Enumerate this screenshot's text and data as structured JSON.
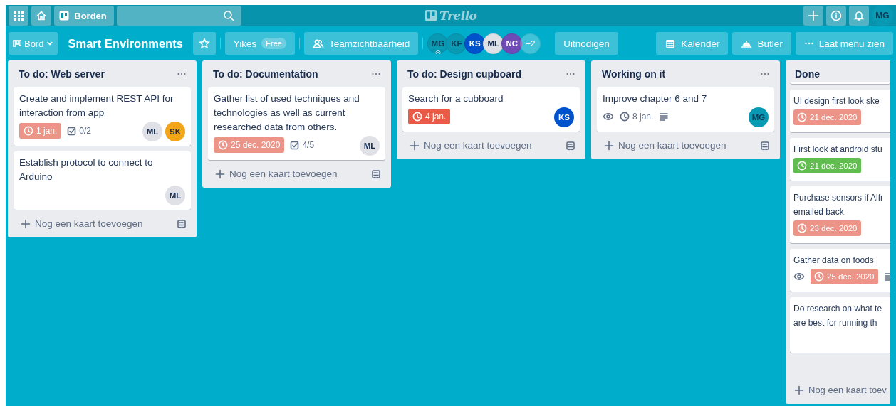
{
  "topbar": {
    "boards_label": "Borden",
    "logo": "Trello",
    "user_initials": "MG"
  },
  "board_header": {
    "view_label": "Bord",
    "title": "Smart Environments",
    "starred": false,
    "workspace": "Yikes",
    "plan": "Free",
    "visibility": "Teamzichtbaarheid",
    "members": [
      {
        "initials": "MG",
        "color": "#0a99b3",
        "admin": true
      },
      {
        "initials": "KF",
        "color": "#0a99b3",
        "admin": false
      },
      {
        "initials": "KS",
        "color": "#0052cc",
        "admin": false
      },
      {
        "initials": "ML",
        "color": "#dfe1e6",
        "admin": false
      },
      {
        "initials": "NC",
        "color": "#6e4bb7",
        "admin": false
      }
    ],
    "more_members": "+2",
    "invite": "Uitnodigen",
    "calendar": "Kalender",
    "butler": "Butler",
    "menu": "Laat menu zien"
  },
  "lists": [
    {
      "title": "To do: Web server",
      "add_card": "Nog een kaart toevoegen",
      "cards": [
        {
          "title": "Create and implement REST API for interaction from app",
          "watching": false,
          "due": {
            "text": "1 jan.",
            "color": "#ec9488"
          },
          "checklist": "0/2",
          "description": false,
          "members": [
            {
              "initials": "ML",
              "color": "#dfe1e6"
            },
            {
              "initials": "SK",
              "color": "#f2a516"
            }
          ]
        },
        {
          "title": "Establish protocol to connect to Arduino",
          "watching": false,
          "description": false,
          "members": [
            {
              "initials": "ML",
              "color": "#dfe1e6"
            }
          ]
        }
      ]
    },
    {
      "title": "To do: Documentation",
      "add_card": "Nog een kaart toevoegen",
      "cards": [
        {
          "title": "Gather list of used techniques and technologies as well as current researched data from others.",
          "watching": false,
          "due": {
            "text": "25 dec. 2020",
            "color": "#ec9488"
          },
          "checklist": "4/5",
          "description": false,
          "members": [
            {
              "initials": "ML",
              "color": "#dfe1e6"
            }
          ]
        }
      ]
    },
    {
      "title": "To do: Design cupboard",
      "add_card": "Nog een kaart toevoegen",
      "cards": [
        {
          "title": "Search for a cubboard",
          "watching": false,
          "due": {
            "text": "4 jan.",
            "color": "#eb5a46"
          },
          "description": false,
          "members": [
            {
              "initials": "KS",
              "color": "#0052cc"
            }
          ]
        }
      ]
    },
    {
      "title": "Working on it",
      "add_card": "Nog een kaart toevoegen",
      "cards": [
        {
          "title": "Improve chapter 6 and 7",
          "watching": true,
          "due": {
            "text": "8 jan."
          },
          "description": true,
          "members": [
            {
              "initials": "MG",
              "color": "#0a99b3"
            }
          ]
        }
      ]
    },
    {
      "title": "Done",
      "add_card": "Nog een kaart toev",
      "cut": true,
      "cards": [
        {
          "title": "UI design first look ske",
          "watching": false,
          "due": {
            "text": "21 dec. 2020",
            "color": "#ec9488"
          },
          "description": false
        },
        {
          "title": "First look at android stu",
          "watching": false,
          "due": {
            "text": "21 dec. 2020",
            "color": "#61bd4f"
          },
          "description": false
        },
        {
          "title": "Purchase sensors if Alfr\nemailed back",
          "watching": false,
          "due": {
            "text": "23 dec. 2020",
            "color": "#ec9488"
          },
          "description": false
        },
        {
          "title": "Gather data on foods",
          "watching": true,
          "due": {
            "text": "25 dec. 2020",
            "color": "#ec9488"
          },
          "description": true
        },
        {
          "title": "Do research on what te\nare best for running th",
          "watching": false,
          "description": false,
          "tall": true
        }
      ]
    }
  ]
}
